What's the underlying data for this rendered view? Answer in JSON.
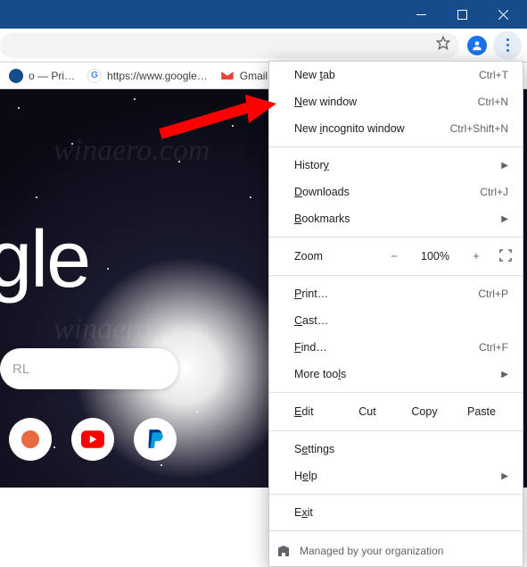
{
  "titlebar": {
    "minimize": "Minimize",
    "maximize": "Maximize",
    "close": "Close"
  },
  "omnibox": {
    "star": "Bookmark this page",
    "profile": "Profile",
    "menu": "Menu"
  },
  "bookmarks": [
    {
      "label": "o — Pri…",
      "icon": "pri"
    },
    {
      "label": "https://www.google…",
      "icon": "goog"
    },
    {
      "label": "Gmail",
      "icon": "gmail"
    }
  ],
  "page": {
    "logo": "oogle",
    "search_placeholder": "RL"
  },
  "shortcuts": [
    "generic",
    "youtube",
    "paypal"
  ],
  "menu": {
    "new_tab": "New tab",
    "new_tab_key": "Ctrl+T",
    "new_window": "New window",
    "new_window_key": "Ctrl+N",
    "incognito": "New incognito window",
    "incognito_key": "Ctrl+Shift+N",
    "history": "History",
    "downloads": "Downloads",
    "downloads_key": "Ctrl+J",
    "bookmarks": "Bookmarks",
    "zoom_label": "Zoom",
    "zoom_value": "100%",
    "print": "Print…",
    "print_key": "Ctrl+P",
    "cast": "Cast…",
    "find": "Find…",
    "find_key": "Ctrl+F",
    "more_tools": "More tools",
    "edit_label": "Edit",
    "cut": "Cut",
    "copy": "Copy",
    "paste": "Paste",
    "settings": "Settings",
    "help": "Help",
    "exit": "Exit",
    "managed": "Managed by your organization"
  }
}
